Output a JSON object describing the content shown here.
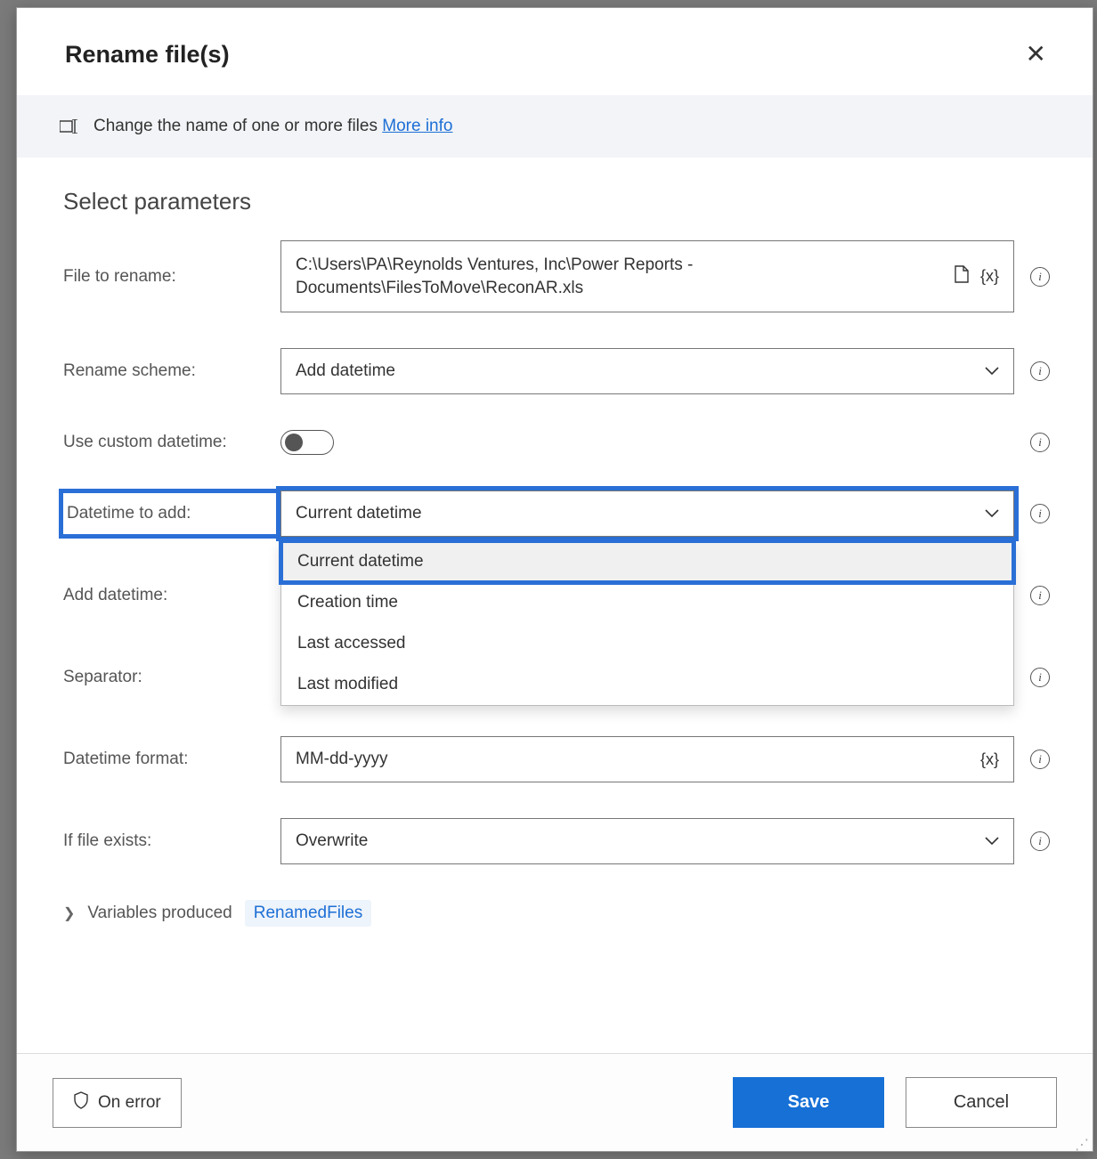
{
  "dialog": {
    "title": "Rename file(s)",
    "info_text": "Change the name of one or more files ",
    "info_link": "More info"
  },
  "section_title": "Select parameters",
  "fields": {
    "file_to_rename": {
      "label": "File to rename:",
      "value": "C:\\Users\\PA\\Reynolds Ventures, Inc\\Power Reports - Documents\\FilesToMove\\ReconAR.xls"
    },
    "rename_scheme": {
      "label": "Rename scheme:",
      "value": "Add datetime"
    },
    "use_custom": {
      "label": "Use custom datetime:",
      "value": false
    },
    "datetime_to_add": {
      "label": "Datetime to add:",
      "value": "Current datetime",
      "options": [
        "Current datetime",
        "Creation time",
        "Last accessed",
        "Last modified"
      ]
    },
    "add_datetime": {
      "label": "Add datetime:"
    },
    "separator": {
      "label": "Separator:"
    },
    "datetime_format": {
      "label": "Datetime format:",
      "value": "MM-dd-yyyy"
    },
    "if_file_exists": {
      "label": "If file exists:",
      "value": "Overwrite"
    }
  },
  "vars": {
    "label": "Variables produced",
    "pill": "RenamedFiles"
  },
  "footer": {
    "on_error": "On error",
    "save": "Save",
    "cancel": "Cancel"
  }
}
